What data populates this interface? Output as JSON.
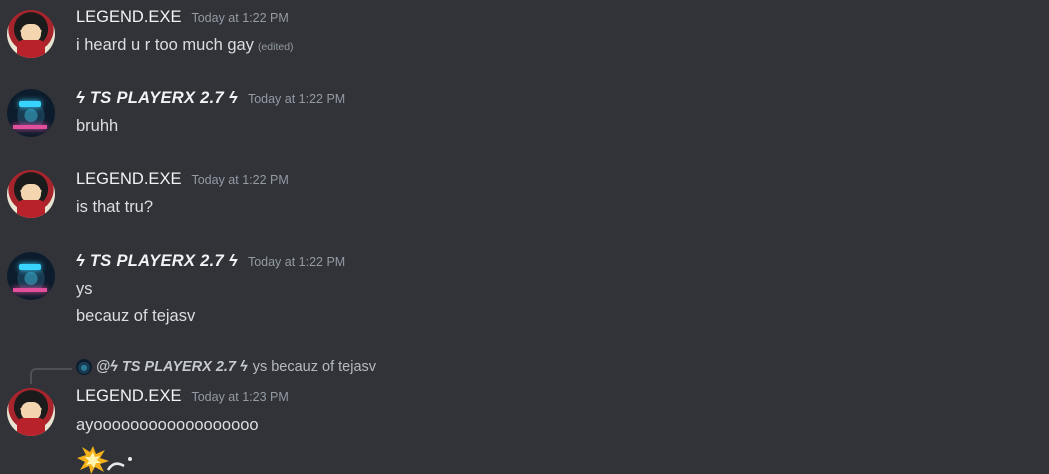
{
  "messages": [
    {
      "username": "LEGEND.EXE",
      "timestamp": "Today at 1:22 PM",
      "lines": [
        "i heard u r too much gay"
      ],
      "edited_label": "(edited)"
    },
    {
      "username": "ϟ TS PLAYERX 2.7 ϟ",
      "timestamp": "Today at 1:22 PM",
      "lines": [
        "bruhh"
      ]
    },
    {
      "username": "LEGEND.EXE",
      "timestamp": "Today at 1:22 PM",
      "lines": [
        "is that tru?"
      ]
    },
    {
      "username": "ϟ TS PLAYERX 2.7 ϟ",
      "timestamp": "Today at 1:22 PM",
      "lines": [
        "ys",
        "becauz of tejasv"
      ]
    },
    {
      "reply": {
        "username": "@ϟ TS PLAYERX 2.7 ϟ",
        "text": "ys becauz of tejasv"
      },
      "username": "LEGEND.EXE",
      "timestamp": "Today at 1:23 PM",
      "lines": [
        "ayoooooooooooooooooo"
      ]
    }
  ],
  "colors": {
    "background": "#313338",
    "username": "#f2f3f5",
    "text": "#dbdee1",
    "muted": "#949ba4"
  },
  "icons": [
    "boom-icon",
    "pointer-icon"
  ]
}
